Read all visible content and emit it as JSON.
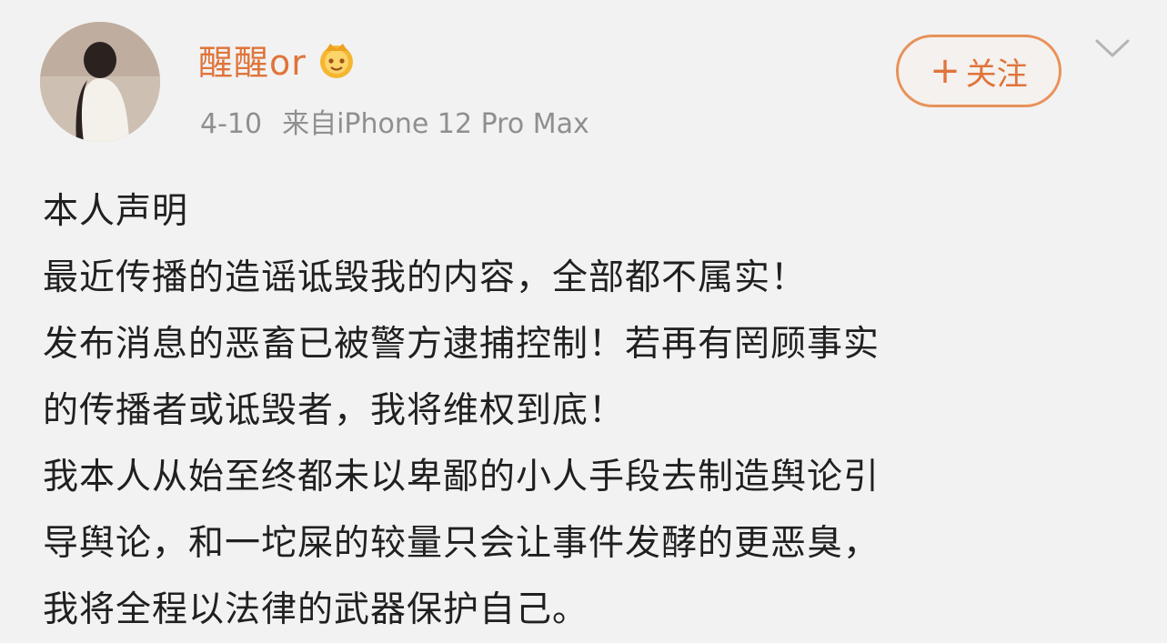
{
  "post": {
    "author": {
      "name": "醒醒or",
      "avatar_icon": "user-avatar",
      "badge_icon": "crown-badge-icon"
    },
    "meta": {
      "date": "4-10",
      "source": "来自iPhone 12 Pro Max"
    },
    "follow_button": {
      "label": "关注",
      "icon": "plus-icon"
    },
    "more_icon": "chevron-down-icon",
    "content_lines": [
      "本人声明",
      "最近传播的造谣诋毁我的内容，全部都不属实！",
      "发布消息的恶畜已被警方逮捕控制！若再有罔顾事实",
      "的传播者或诋毁者，我将维权到底！",
      "我本人从始至终都未以卑鄙的小人手段去制造舆论引",
      "导舆论，和一坨屎的较量只会让事件发酵的更恶臭，",
      "我将全程以法律的武器保护自己。"
    ]
  },
  "colors": {
    "background": "#f2f2f2",
    "accent": "#e0743a",
    "text": "#202020",
    "meta_text": "#8f8f8f"
  }
}
